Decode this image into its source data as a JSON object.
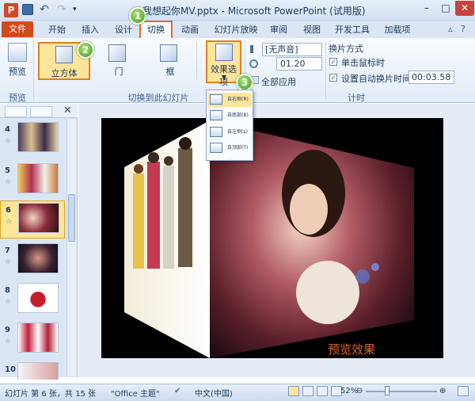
{
  "window": {
    "title": "我想起你MV.pptx - Microsoft PowerPoint (试用版)",
    "logo": "P",
    "controls": {
      "minimize": "–",
      "maximize": "□",
      "close": "✕"
    }
  },
  "qat": {
    "undo": "↶",
    "redo": "↷",
    "more": "▾"
  },
  "tabs": [
    {
      "label": "文件"
    },
    {
      "label": "开始"
    },
    {
      "label": "插入"
    },
    {
      "label": "设计"
    },
    {
      "label": "切换"
    },
    {
      "label": "动画"
    },
    {
      "label": "幻灯片放映"
    },
    {
      "label": "审阅"
    },
    {
      "label": "视图"
    },
    {
      "label": "开发工具"
    },
    {
      "label": "加载项"
    }
  ],
  "ribbon_controls": {
    "collapse": "▵",
    "help": "?"
  },
  "ribbon": {
    "preview": {
      "button_label": "预览",
      "group_label": "预览"
    },
    "transitions_group": {
      "group_label": "切换到此幻灯片",
      "gallery": [
        {
          "label": "立方体",
          "selected": true
        },
        {
          "label": "门"
        },
        {
          "label": "框"
        }
      ],
      "effect_options_label": "效果选项",
      "effect_options_arrow": "▼"
    },
    "timing_group": {
      "group_label": "计时",
      "sound": "[无声音]",
      "duration": "01.20",
      "apply_all": "全部应用",
      "advance_title": "换片方式",
      "on_click": {
        "label": "单击鼠标时",
        "checked": true
      },
      "after": {
        "label": "设置自动换片时间:",
        "checked": true,
        "value": "00:03.58"
      },
      "check_mark": "✓"
    }
  },
  "callouts": [
    "1",
    "2",
    "3"
  ],
  "effect_menu": {
    "items": [
      "自右侧(R)",
      "自底部(B)",
      "自左侧(L)",
      "自顶部(T)"
    ],
    "selected_index": 0,
    "grip": "···"
  },
  "slides_panel": {
    "close": "✕",
    "star": "☆",
    "slides": [
      {
        "number": "4"
      },
      {
        "number": "5"
      },
      {
        "number": "6",
        "selected": true
      },
      {
        "number": "7"
      },
      {
        "number": "8"
      },
      {
        "number": "9"
      },
      {
        "number": "10"
      }
    ]
  },
  "slide": {
    "caption": "预览效果"
  },
  "status": {
    "slide_info": "幻灯片 第 6 张，共 15 张",
    "theme": "\"Office 主题\"",
    "language": "中文(中国)",
    "zoom": "52%",
    "zoom_minus": "⊖",
    "zoom_plus": "⊕"
  },
  "colors": {
    "file_tab": "#d2491f",
    "highlight": "#e36b1e",
    "caption": "#e16420",
    "selected_fill": "#fde59a"
  }
}
